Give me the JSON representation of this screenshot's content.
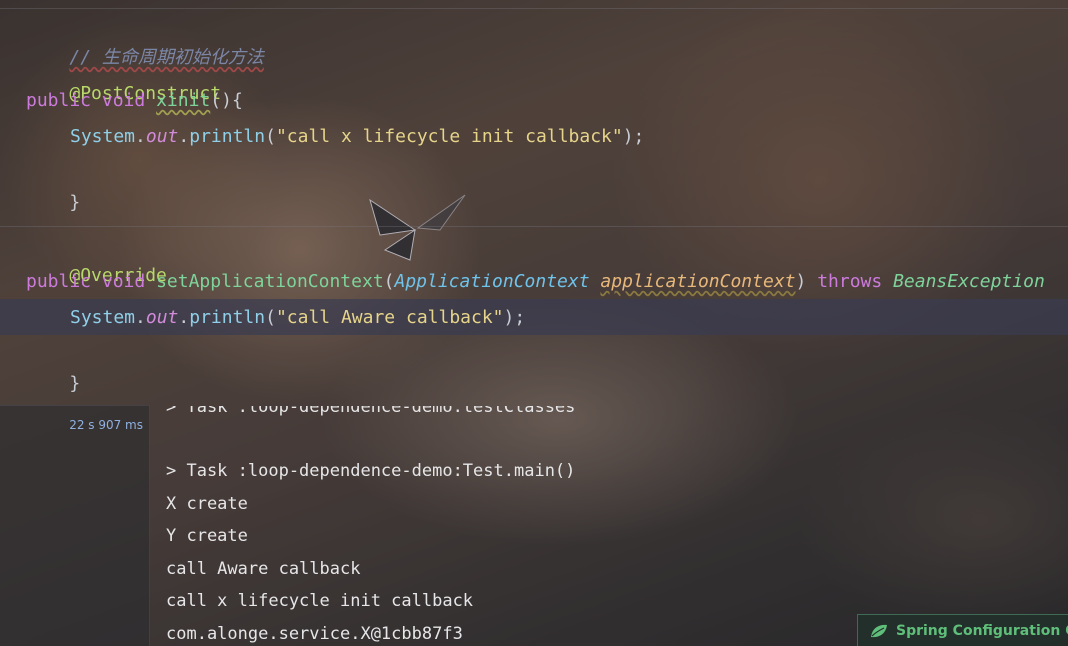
{
  "editor": {
    "comment": "// 生命周期初始化方法",
    "anno_postconstruct": "@PostConstruct",
    "kw_public": "public",
    "kw_void": "void",
    "method_xinit": "xinit",
    "xinit_parens": "(){",
    "system": "System",
    "out": "out",
    "println": "println",
    "str_lifecycle": "\"call x lifecycle init callback\"",
    "close_stmt": ");",
    "close_brace": "}",
    "anno_override": "@Override",
    "method_setctx": "setApplicationContext",
    "param_type": "ApplicationContext",
    "param_name": "applicationContext",
    "kw_throws": "throws",
    "exc_type": "BeansException",
    "str_aware": "\"call Aware callback\""
  },
  "console": {
    "elapsed": "22 s 907 ms",
    "lines": [
      "> Task :loop-dependence-demo:testClasses",
      "",
      "> Task :loop-dependence-demo:Test.main()",
      "X create",
      "Y create",
      "call Aware callback",
      "call x lifecycle init callback",
      "com.alonge.service.X@1cbb87f3"
    ]
  },
  "status_tab": {
    "label": "Spring Configuration Che",
    "icon": "spring-leaf-icon",
    "color": "#5fbf7a"
  }
}
